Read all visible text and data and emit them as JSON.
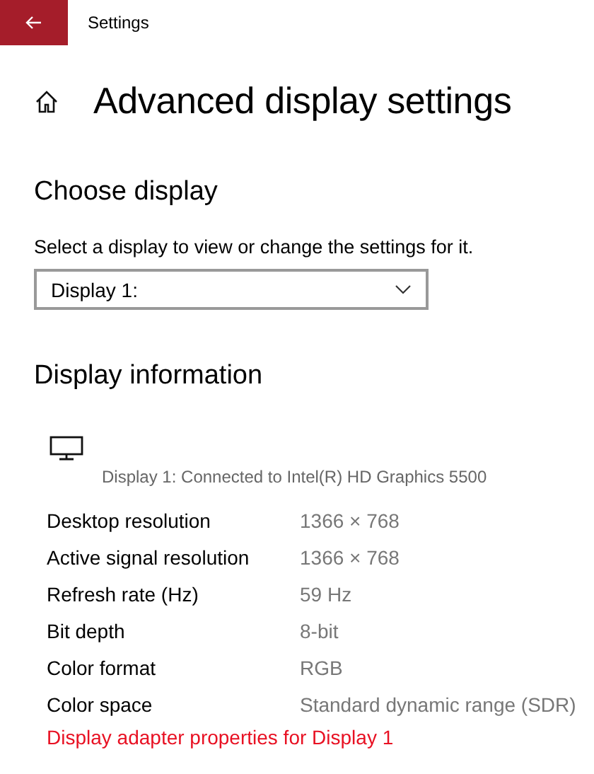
{
  "window": {
    "title": "Settings"
  },
  "page": {
    "title": "Advanced display settings"
  },
  "choose_display": {
    "heading": "Choose display",
    "prompt": "Select a display to view or change the settings for it.",
    "dropdown": {
      "value": "Display 1:"
    }
  },
  "display_information": {
    "heading": "Display information",
    "connection": "Display 1: Connected to Intel(R) HD Graphics 5500",
    "rows": [
      {
        "label": "Desktop resolution",
        "value": "1366 × 768"
      },
      {
        "label": "Active signal resolution",
        "value": "1366 × 768"
      },
      {
        "label": "Refresh rate (Hz)",
        "value": "59 Hz"
      },
      {
        "label": "Bit depth",
        "value": "8-bit"
      },
      {
        "label": "Color format",
        "value": "RGB"
      },
      {
        "label": "Color space",
        "value": "Standard dynamic range (SDR)"
      }
    ],
    "link": "Display adapter properties for Display 1"
  }
}
